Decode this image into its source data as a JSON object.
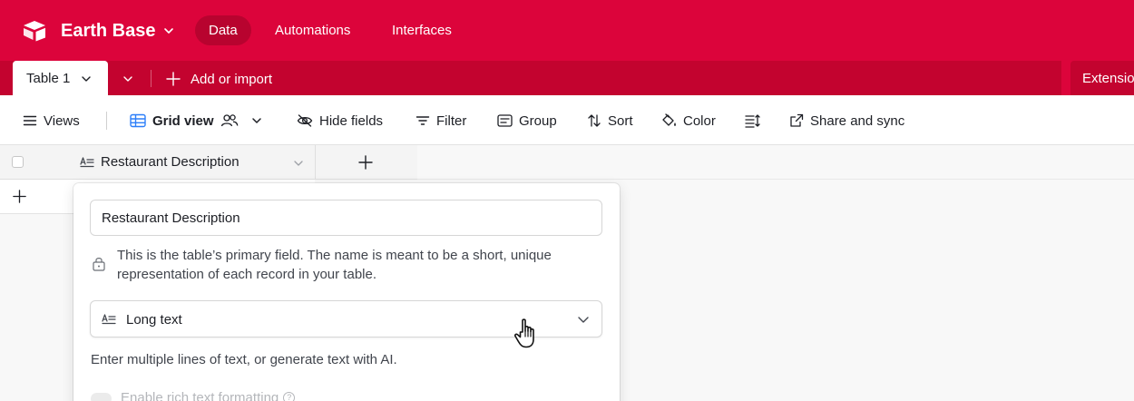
{
  "header": {
    "base_name": "Earth Base",
    "nav_tabs": [
      {
        "label": "Data",
        "active": true
      },
      {
        "label": "Automations",
        "active": false
      },
      {
        "label": "Interfaces",
        "active": false
      }
    ]
  },
  "tablebar": {
    "table_tab": "Table 1",
    "add_import": "Add or import",
    "extensions": "Extensions"
  },
  "toolbar": {
    "views": "Views",
    "view_name": "Grid view",
    "hide_fields": "Hide fields",
    "filter": "Filter",
    "group": "Group",
    "sort": "Sort",
    "color": "Color",
    "share": "Share and sync"
  },
  "grid": {
    "primary_field": "Restaurant Description"
  },
  "field_editor": {
    "name_value": "Restaurant Description",
    "hint": "This is the table’s primary field. The name is meant to be a short, unique representation of each record in your table.",
    "type_label": "Long text",
    "type_description": "Enter multiple lines of text, or generate text with AI.",
    "rich_text_label": "Enable rich text formatting",
    "help_glyph": "?"
  },
  "colors": {
    "brand": "#dc043b",
    "brand_dark": "#c3032f",
    "active_tab": "#b8032f",
    "toolbar_icon_blue": "#2d7ff9"
  },
  "icons": {
    "logo": "airtable-logo-icon",
    "cursor": "hand-pointer-icon"
  }
}
